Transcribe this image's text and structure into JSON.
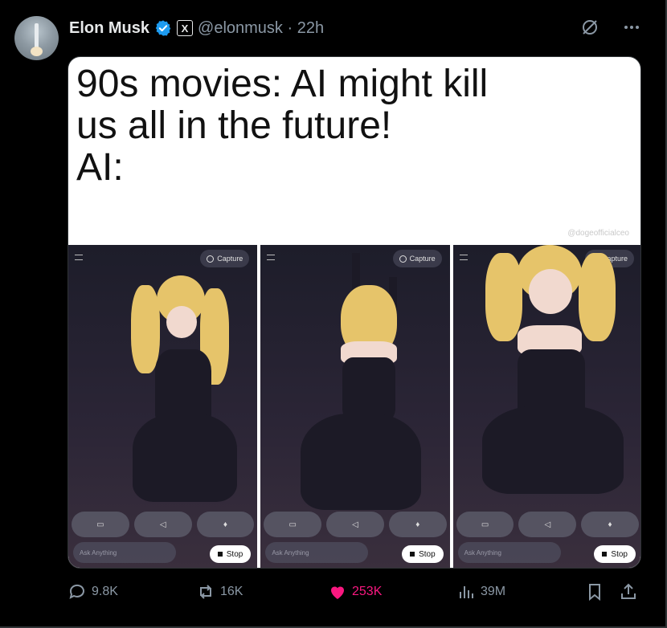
{
  "post": {
    "author_name": "Elon Musk",
    "handle": "@elonmusk",
    "separator": "·",
    "time": "22h",
    "x_badge": "X"
  },
  "media": {
    "caption_lines": [
      "90s movies: AI might kill",
      "us all in the future!",
      "AI:"
    ],
    "watermark": "@dogeofficialceo",
    "panels": [
      {
        "capture_label": "Capture",
        "ask_placeholder": "Ask Anything",
        "stop_label": "Stop"
      },
      {
        "capture_label": "Capture",
        "ask_placeholder": "Ask Anything",
        "stop_label": "Stop"
      },
      {
        "capture_label": "Capture",
        "ask_placeholder": "Ask Anything",
        "stop_label": "Stop"
      }
    ]
  },
  "actions": {
    "replies": "9.8K",
    "reposts": "16K",
    "likes": "253K",
    "views": "39M"
  },
  "colors": {
    "verified": "#1d9bf0",
    "like": "#f91880",
    "muted": "#8b98a5"
  }
}
